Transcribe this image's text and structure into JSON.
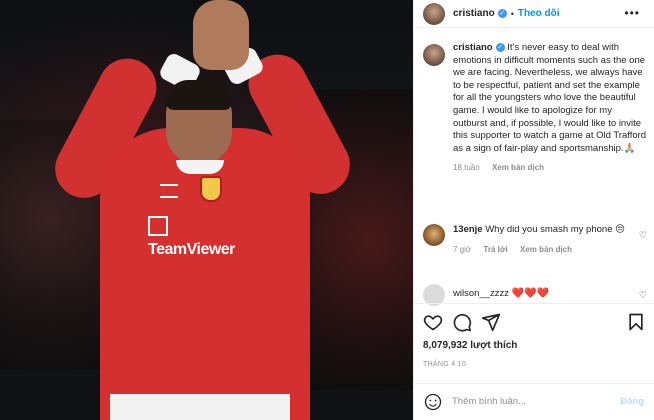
{
  "header": {
    "username": "cristiano",
    "follow_label": "Theo dõi",
    "separator": "•",
    "more_label": "•••"
  },
  "caption": {
    "username": "cristiano",
    "text": "It’s never easy to deal with emotions in difficult moments such as the one we are facing. Nevertheless, we always have to be respectful, patient and set the example for all the youngsters who love the beautiful game. I would like to apologize for my outburst and, if possible, I would like to invite this supporter to watch a game at Old Trafford as a sign of fair-play and sportsmanship.🙏🏼",
    "time": "18 tuần",
    "translate_label": "Xem bản dịch"
  },
  "comments": [
    {
      "username": "13enje",
      "text": "Why did you smash my phone 😔",
      "time": "7 giờ",
      "reply_label": "Trả lời",
      "translate_label": "Xem bản dịch"
    },
    {
      "username": "wilson__zzzz",
      "text": "❤️❤️❤️"
    }
  ],
  "photo": {
    "sponsor_text": "TeamViewer"
  },
  "likes": "8,079,932 lượt thích",
  "date": "THÁNG 4 10",
  "comment_box": {
    "placeholder": "Thêm bình luận...",
    "post_label": "Đăng"
  },
  "icons": {
    "like": "heart-icon",
    "comment": "comment-icon",
    "share": "share-icon",
    "save": "bookmark-icon",
    "emoji": "emoji-icon"
  },
  "colors": {
    "accent": "#0095f6",
    "verified": "#3897f0",
    "heart_red": "#e0252f",
    "shirt_red": "#d3302f"
  }
}
